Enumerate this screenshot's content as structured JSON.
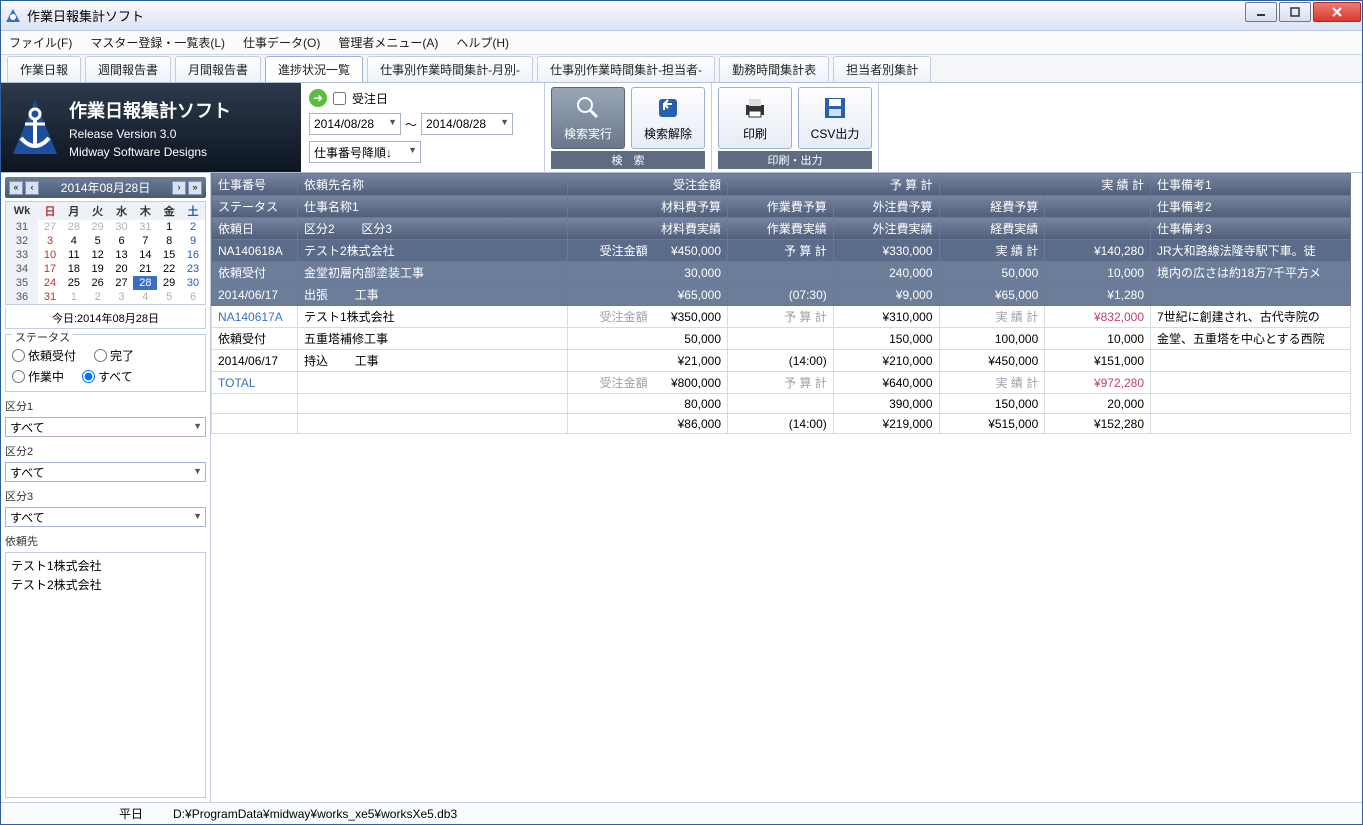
{
  "window_title": "作業日報集計ソフト",
  "menu": [
    "ファイル(F)",
    "マスター登録・一覧表(L)",
    "仕事データ(O)",
    "管理者メニュー(A)",
    "ヘルプ(H)"
  ],
  "tabs": [
    "作業日報",
    "週間報告書",
    "月間報告書",
    "進捗状況一覧",
    "仕事別作業時間集計-月別-",
    "仕事別作業時間集計-担当者-",
    "勤務時間集計表",
    "担当者別集計"
  ],
  "active_tab": 3,
  "logo": {
    "title": "作業日報集計ソフト",
    "version": "Release Version 3.0",
    "vendor": "Midway Software Designs"
  },
  "search": {
    "order_date_label": "受注日",
    "date_from": "2014/08/28",
    "tilde": "～",
    "date_to": "2014/08/28",
    "sort": "仕事番号降順↓"
  },
  "buttons": {
    "search_exec": "検索実行",
    "search_clear": "検索解除",
    "print": "印刷",
    "csv": "CSV出力",
    "search_group": "検　索",
    "output_group": "印刷・出力"
  },
  "calendar": {
    "title": "2014年08月28日",
    "dow": [
      "Wk",
      "日",
      "月",
      "火",
      "水",
      "木",
      "金",
      "土"
    ],
    "weeks": [
      {
        "wk": "31",
        "d": [
          "27",
          "28",
          "29",
          "30",
          "31",
          "1",
          "2"
        ],
        "other": [
          0,
          1,
          2,
          3,
          4
        ]
      },
      {
        "wk": "32",
        "d": [
          "3",
          "4",
          "5",
          "6",
          "7",
          "8",
          "9"
        ]
      },
      {
        "wk": "33",
        "d": [
          "10",
          "11",
          "12",
          "13",
          "14",
          "15",
          "16"
        ]
      },
      {
        "wk": "34",
        "d": [
          "17",
          "18",
          "19",
          "20",
          "21",
          "22",
          "23"
        ]
      },
      {
        "wk": "35",
        "d": [
          "24",
          "25",
          "26",
          "27",
          "28",
          "29",
          "30"
        ],
        "today": 4
      },
      {
        "wk": "36",
        "d": [
          "31",
          "1",
          "2",
          "3",
          "4",
          "5",
          "6"
        ],
        "other": [
          1,
          2,
          3,
          4,
          5,
          6
        ]
      }
    ],
    "today_line": "今日:2014年08月28日"
  },
  "status_group": {
    "legend": "ステータス",
    "r1": "依頼受付",
    "r2": "完了",
    "r3": "作業中",
    "r4": "すべて",
    "selected": "r4"
  },
  "filters": {
    "k1": "区分1",
    "k2": "区分2",
    "k3": "区分3",
    "all": "すべて",
    "client_label": "依頼先",
    "clients": [
      "テスト1株式会社",
      "テスト2株式会社"
    ]
  },
  "grid": {
    "headers": {
      "r1": [
        "仕事番号",
        "依頼先名称",
        "受注金額",
        "",
        "予 算 計",
        "",
        "実 績 計",
        "",
        "仕事備考1"
      ],
      "r2": [
        "ステータス",
        "仕事名称1",
        "材料費予算",
        "作業費予算",
        "",
        "外注費予算",
        "経費予算",
        "",
        "仕事備考2"
      ],
      "r3": [
        "依頼日",
        "区分2",
        "区分3",
        "材料費実績",
        "作業費実績",
        "",
        "外注費実績",
        "経費実績",
        "",
        "仕事備考3"
      ]
    },
    "jobs": [
      {
        "sel": true,
        "r1": [
          "NA140618A",
          "テスト2株式会社",
          "受注金額",
          "¥450,000",
          "予 算 計",
          "¥330,000",
          "実 績 計",
          "¥140,280",
          "JR大和路線法隆寺駅下車。徒"
        ],
        "r2": [
          "依頼受付",
          "金堂初層内部塗装工事",
          "30,000",
          "",
          "240,000",
          "50,000",
          "10,000",
          "境内の広さは約18万7千平方メ"
        ],
        "r3": [
          "2014/06/17",
          "出張",
          "工事",
          "¥65,000",
          "(07:30)",
          "¥9,000",
          "¥65,000",
          "¥1,280",
          ""
        ]
      },
      {
        "sel": false,
        "r1": [
          "NA140617A",
          "テスト1株式会社",
          "受注金額",
          "¥350,000",
          "予 算 計",
          "¥310,000",
          "実 績 計",
          "¥832,000",
          "7世紀に創建され、古代寺院の"
        ],
        "r2": [
          "依頼受付",
          "五重塔補修工事",
          "50,000",
          "",
          "150,000",
          "100,000",
          "10,000",
          "金堂、五重塔を中心とする西院"
        ],
        "r3": [
          "2014/06/17",
          "持込",
          "工事",
          "¥21,000",
          "(14:00)",
          "¥210,000",
          "¥450,000",
          "¥151,000",
          ""
        ]
      }
    ],
    "total": {
      "r1": [
        "TOTAL",
        "",
        "受注金額",
        "¥800,000",
        "予 算 計",
        "¥640,000",
        "実 績 計",
        "¥972,280"
      ],
      "r2": [
        "",
        "",
        "80,000",
        "",
        "390,000",
        "150,000",
        "20,000"
      ],
      "r3": [
        "",
        "",
        "",
        "¥86,000",
        "(14:00)",
        "¥219,000",
        "¥515,000",
        "¥152,280"
      ]
    }
  },
  "statusbar": {
    "daytype": "平日",
    "path": "D:¥ProgramData¥midway¥works_xe5¥worksXe5.db3"
  }
}
